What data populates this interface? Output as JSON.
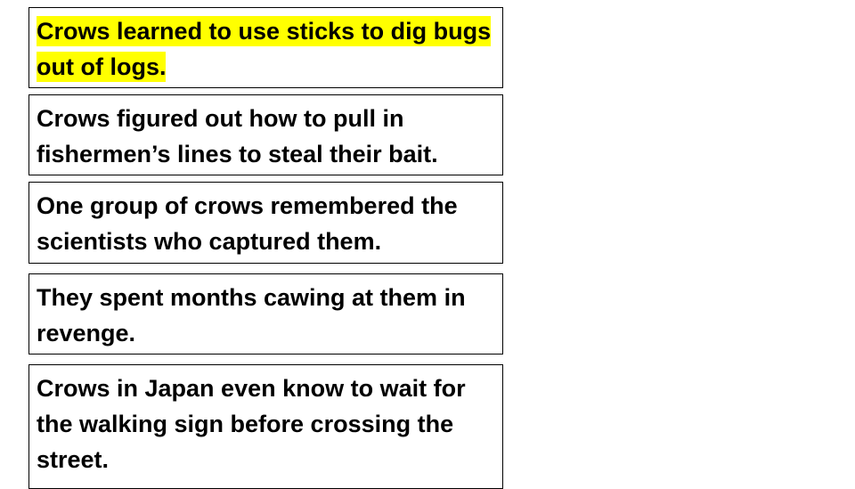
{
  "slide": {
    "colors": {
      "highlight": "#ffff00",
      "text": "#000000",
      "border": "#000000",
      "background": "#ffffff"
    },
    "cards": [
      {
        "text": "Crows learned to use sticks to dig bugs out of logs.",
        "highlighted": true
      },
      {
        "text": "Crows figured out how to pull in fishermen’s lines to steal their bait.",
        "highlighted": false
      },
      {
        "text": "One group of crows remembered the scientists who captured them.",
        "highlighted": false
      },
      {
        "text": "They spent months cawing at them in revenge.",
        "highlighted": false
      },
      {
        "text": "Crows in Japan even know to wait for the walking sign before crossing the street.",
        "highlighted": false
      }
    ]
  }
}
